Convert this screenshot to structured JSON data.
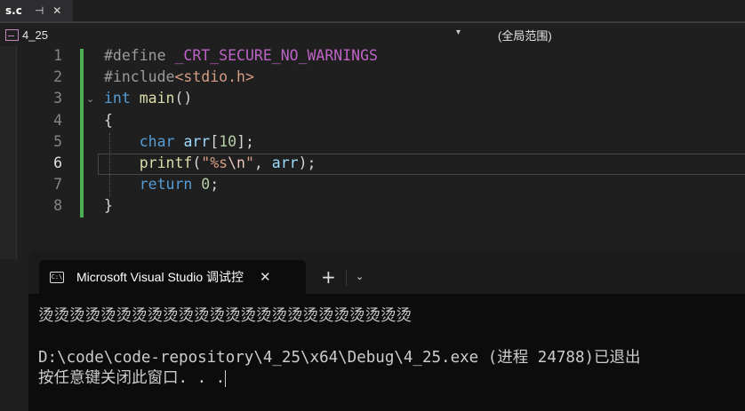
{
  "tab": {
    "filename": "s.c",
    "pin_glyph": "⊣",
    "close_glyph": "✕"
  },
  "navbar": {
    "project": "4_25",
    "scope": "(全局范围)",
    "dropdown_glyph": "▾"
  },
  "editor": {
    "lines": [
      {
        "n": "1",
        "tokens": [
          {
            "c": "k-pre",
            "t": "#define "
          },
          {
            "c": "k-macro",
            "t": "_CRT_SECURE_NO_WARNINGS"
          }
        ]
      },
      {
        "n": "2",
        "tokens": [
          {
            "c": "k-pre",
            "t": "#include"
          },
          {
            "c": "k-str",
            "t": "<stdio.h>"
          }
        ]
      },
      {
        "n": "3",
        "tokens": [
          {
            "c": "k-kw",
            "t": "int"
          },
          {
            "c": "",
            "t": " "
          },
          {
            "c": "k-fn",
            "t": "main"
          },
          {
            "c": "",
            "t": "()"
          }
        ]
      },
      {
        "n": "4",
        "tokens": [
          {
            "c": "",
            "t": "{"
          }
        ]
      },
      {
        "n": "5",
        "tokens": [
          {
            "c": "",
            "t": "    "
          },
          {
            "c": "k-kw",
            "t": "char"
          },
          {
            "c": "",
            "t": " "
          },
          {
            "c": "k-var",
            "t": "arr"
          },
          {
            "c": "",
            "t": "["
          },
          {
            "c": "k-num",
            "t": "10"
          },
          {
            "c": "",
            "t": "];"
          }
        ]
      },
      {
        "n": "6",
        "tokens": [
          {
            "c": "",
            "t": "    "
          },
          {
            "c": "k-fn",
            "t": "printf"
          },
          {
            "c": "",
            "t": "("
          },
          {
            "c": "k-str",
            "t": "\"%s"
          },
          {
            "c": "k-esc",
            "t": "\\n"
          },
          {
            "c": "k-str",
            "t": "\""
          },
          {
            "c": "",
            "t": ", "
          },
          {
            "c": "k-var",
            "t": "arr"
          },
          {
            "c": "",
            "t": ");"
          }
        ]
      },
      {
        "n": "7",
        "tokens": [
          {
            "c": "",
            "t": "    "
          },
          {
            "c": "k-kw",
            "t": "return"
          },
          {
            "c": "",
            "t": " "
          },
          {
            "c": "k-num",
            "t": "0"
          },
          {
            "c": "",
            "t": ";"
          }
        ]
      },
      {
        "n": "8",
        "tokens": [
          {
            "c": "",
            "t": "}"
          }
        ]
      }
    ],
    "active_line": "6",
    "fold_glyph": "⌄"
  },
  "terminal": {
    "tab_title": "Microsoft Visual Studio 调试控",
    "icon_label": "C:\\",
    "close_glyph": "✕",
    "new_tab_glyph": "+",
    "menu_glyph": "⌄",
    "output": [
      "烫烫烫烫烫烫烫烫烫烫烫烫烫烫烫烫烫烫烫烫烫烫烫烫",
      "",
      "D:\\code\\code-repository\\4_25\\x64\\Debug\\4_25.exe (进程 24788)已退出",
      "按任意键关闭此窗口. . ."
    ]
  }
}
